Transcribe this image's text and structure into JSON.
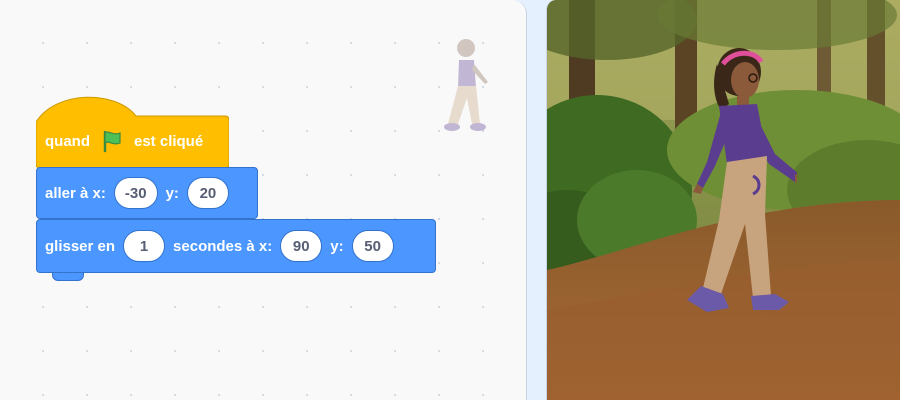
{
  "blocks": {
    "when_flag": {
      "label_before": "quand",
      "label_after": "est cliqué"
    },
    "goto_xy": {
      "label": "aller à x:",
      "x_value": "-30",
      "y_label": "y:",
      "y_value": "20"
    },
    "glide": {
      "label": "glisser en",
      "secs_value": "1",
      "label_mid": "secondes à x:",
      "x_value": "90",
      "y_label": "y:",
      "y_value": "50"
    }
  },
  "colors": {
    "events": "#ffbf00",
    "motion": "#4c97ff",
    "flag": "#4cbf56",
    "shirt": "#5b3d8f",
    "pants": "#c8a47e"
  },
  "icons": {
    "flag": "green-flag-icon"
  }
}
